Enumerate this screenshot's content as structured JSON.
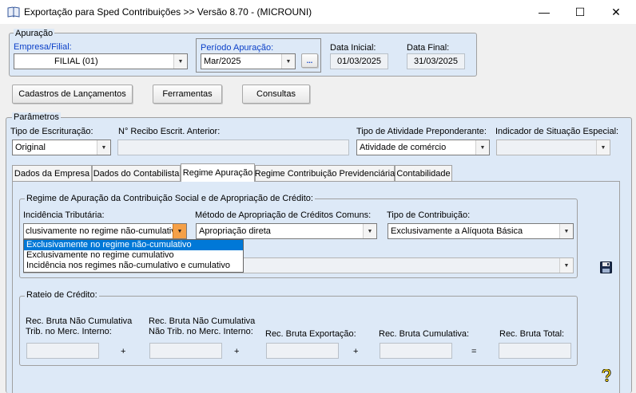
{
  "window": {
    "title": "Exportação para Sped Contribuições >> Versão 8.70 - (MICROUNI)",
    "controls": {
      "minimize": "—",
      "maximize": "☐",
      "close": "✕"
    }
  },
  "apuracao": {
    "legend": "Apuração",
    "empresa_label": "Empresa/Filial:",
    "empresa_value": "FILIAL (01)",
    "periodo_label": "Período Apuração:",
    "periodo_value": "Mar/2025",
    "periodo_button": "...",
    "data_inicial_label": "Data Inicial:",
    "data_inicial_value": "01/03/2025",
    "data_final_label": "Data Final:",
    "data_final_value": "31/03/2025"
  },
  "toolbar": {
    "cadastros": "Cadastros de Lançamentos",
    "ferramentas": "Ferramentas",
    "consultas": "Consultas"
  },
  "parametros": {
    "legend": "Parâmetros",
    "tipo_escrituracao_label": "Tipo de Escrituração:",
    "tipo_escrituracao_value": "Original",
    "recibo_label": "N° Recibo Escrit. Anterior:",
    "recibo_value": "",
    "atividade_label": "Tipo de Atividade Preponderante:",
    "atividade_value": "Atividade de comércio",
    "indicador_label": "Indicador de Situação Especial:",
    "indicador_value": ""
  },
  "tabs": [
    {
      "label": "Dados da Empresa"
    },
    {
      "label": "Dados do Contabilista"
    },
    {
      "label": "Regime Apuração"
    },
    {
      "label": "Regime Contribuição Previdenciária"
    },
    {
      "label": "Contabilidade"
    }
  ],
  "regime": {
    "legend": "Regime de Apuração da Contribuição Social e de Apropriação de Crédito:",
    "incidencia_label": "Incidência Tributária:",
    "incidencia_value": "clusivamente no regime não-cumulativo",
    "metodo_label": "Método de Apropriação de Créditos Comuns:",
    "metodo_value": "Apropriação direta",
    "tipo_contrib_label": "Tipo de Contribuição:",
    "tipo_contrib_value": "Exclusivamente a Alíquota Básica",
    "incidencia_options": [
      "Exclusivamente no regime não-cumulativo",
      "Exclusivamente no regime cumulativo",
      "Incidência nos regimes não-cumulativo e cumulativo"
    ]
  },
  "rateio": {
    "legend": "Rateio de Crédito:",
    "nc_trib_label_1": "Rec. Bruta Não Cumulativa",
    "nc_trib_label_2": "Trib. no Merc. Interno:",
    "nc_ntrib_label_1": "Rec. Bruta Não Cumulativa",
    "nc_ntrib_label_2": "Não Trib. no Merc. Interno:",
    "exportacao_label": "Rec. Bruta Exportação:",
    "cumulativa_label": "Rec. Bruta Cumulativa:",
    "total_label": "Rec. Bruta Total:",
    "op_plus": "+",
    "op_equals": "="
  },
  "icons": {
    "save": "floppy-disk-icon",
    "help": "question-mark-icon"
  },
  "colors": {
    "accent_blue": "#0a3fc8",
    "selection": "#0078d7",
    "panel_bg": "#dde9f7",
    "dropdown_btn": "#f5a047"
  }
}
